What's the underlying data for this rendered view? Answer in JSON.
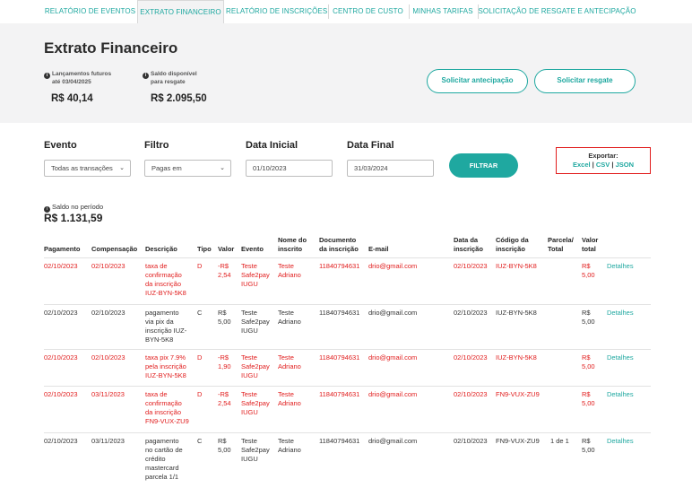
{
  "tabs": [
    {
      "label": "RELATÓRIO DE EVENTOS"
    },
    {
      "label": "EXTRATO FINANCEIRO",
      "active": true
    },
    {
      "label": "RELATÓRIO DE INSCRIÇÕES"
    },
    {
      "label": "CENTRO DE CUSTO"
    },
    {
      "label": "MINHAS TARIFAS"
    },
    {
      "label": "SOLICITAÇÃO DE RESGATE E ANTECIPAÇÃO"
    }
  ],
  "header": {
    "title": "Extrato Financeiro",
    "future_label_1": "Lançamentos futuros",
    "future_label_2": "até 03/04/2025",
    "future_value": "R$ 40,14",
    "available_label_1": "Saldo disponível",
    "available_label_2": "para resgate",
    "available_value": "R$ 2.095,50",
    "btn_anticipation": "Solicitar antecipação",
    "btn_withdraw": "Solicitar resgate"
  },
  "filters": {
    "evento_label": "Evento",
    "evento_value": "Todas as transações",
    "filtro_label": "Filtro",
    "filtro_value": "Pagas em",
    "data_inicial_label": "Data Inicial",
    "data_inicial_value": "01/10/2023",
    "data_final_label": "Data Final",
    "data_final_value": "31/03/2024",
    "filter_button": "FILTRAR"
  },
  "export": {
    "label": "Exportar:",
    "excel": "Excel",
    "csv": "CSV",
    "json": "JSON",
    "sep": "|"
  },
  "saldo": {
    "label": "Saldo no período",
    "value": "R$ 1.131,59"
  },
  "table": {
    "headers": {
      "pagamento": "Pagamento",
      "compensacao": "Compensação",
      "descricao": "Descrição",
      "tipo": "Tipo",
      "valor": "Valor",
      "evento": "Evento",
      "nome_1": "Nome do",
      "nome_2": "inscrito",
      "doc_1": "Documento",
      "doc_2": "da inscrição",
      "email": "E-mail",
      "data_1": "Data da",
      "data_2": "inscrição",
      "codigo_1": "Código da",
      "codigo_2": "inscrição",
      "parcela_1": "Parcela/",
      "parcela_2": "Total",
      "total_1": "Valor",
      "total_2": "total"
    },
    "rows": [
      {
        "highlight": true,
        "pagamento": "02/10/2023",
        "compensacao": "02/10/2023",
        "descricao": [
          "taxa de",
          "confirmação",
          "da inscrição",
          "IUZ-BYN-5K8"
        ],
        "tipo": "D",
        "valor": [
          "-R$",
          "2,54"
        ],
        "evento": [
          "Teste",
          "Safe2pay",
          "IUGU"
        ],
        "nome": [
          "Teste",
          "Adriano"
        ],
        "documento": "11840794631",
        "email": "drio@gmail.com",
        "data": "02/10/2023",
        "codigo": "IUZ-BYN-5K8",
        "parcela": "",
        "total": [
          "R$",
          "5,00"
        ],
        "action": "Detalhes"
      },
      {
        "highlight": false,
        "pagamento": "02/10/2023",
        "compensacao": "02/10/2023",
        "descricao": [
          "pagamento",
          "via pix da",
          "inscrição IUZ-",
          "BYN-5K8"
        ],
        "tipo": "C",
        "valor": [
          "R$",
          "5,00"
        ],
        "evento": [
          "Teste",
          "Safe2pay",
          "IUGU"
        ],
        "nome": [
          "Teste",
          "Adriano"
        ],
        "documento": "11840794631",
        "email": "drio@gmail.com",
        "data": "02/10/2023",
        "codigo": "IUZ-BYN-5K8",
        "parcela": "",
        "total": [
          "R$",
          "5,00"
        ],
        "action": "Detalhes"
      },
      {
        "highlight": true,
        "pagamento": "02/10/2023",
        "compensacao": "02/10/2023",
        "descricao": [
          "taxa pix 7.9%",
          "pela inscrição",
          "IUZ-BYN-5K8"
        ],
        "tipo": "D",
        "valor": [
          "-R$",
          "1,90"
        ],
        "evento": [
          "Teste",
          "Safe2pay",
          "IUGU"
        ],
        "nome": [
          "Teste",
          "Adriano"
        ],
        "documento": "11840794631",
        "email": "drio@gmail.com",
        "data": "02/10/2023",
        "codigo": "IUZ-BYN-5K8",
        "parcela": "",
        "total": [
          "R$",
          "5,00"
        ],
        "action": "Detalhes"
      },
      {
        "highlight": true,
        "pagamento": "02/10/2023",
        "compensacao": "03/11/2023",
        "descricao": [
          "taxa de",
          "confirmação",
          "da inscrição",
          "FN9-VUX-ZU9"
        ],
        "tipo": "D",
        "valor": [
          "-R$",
          "2,54"
        ],
        "evento": [
          "Teste",
          "Safe2pay",
          "IUGU"
        ],
        "nome": [
          "Teste",
          "Adriano"
        ],
        "documento": "11840794631",
        "email": "drio@gmail.com",
        "data": "02/10/2023",
        "codigo": "FN9-VUX-ZU9",
        "parcela": "",
        "total": [
          "R$",
          "5,00"
        ],
        "action": "Detalhes"
      },
      {
        "highlight": false,
        "pagamento": "02/10/2023",
        "compensacao": "03/11/2023",
        "descricao": [
          "pagamento",
          "no cartão de",
          "crédito",
          "mastercard",
          "parcela 1/1"
        ],
        "tipo": "C",
        "valor": [
          "R$",
          "5,00"
        ],
        "evento": [
          "Teste",
          "Safe2pay",
          "IUGU"
        ],
        "nome": [
          "Teste",
          "Adriano"
        ],
        "documento": "11840794631",
        "email": "drio@gmail.com",
        "data": "02/10/2023",
        "codigo": "FN9-VUX-ZU9",
        "parcela": "1 de 1",
        "total": [
          "R$",
          "5,00"
        ],
        "action": "Detalhes"
      }
    ]
  },
  "colors": {
    "accent": "#1fa8a0",
    "debit": "#e11d1d",
    "band": "#f3f3f4"
  }
}
